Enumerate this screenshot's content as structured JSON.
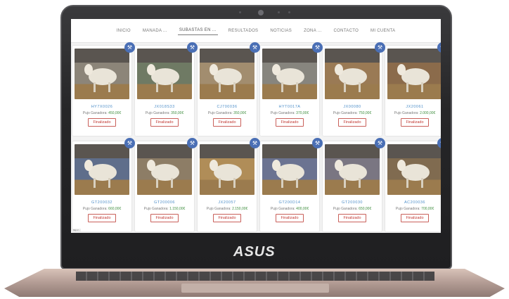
{
  "brand_logo": "ASUS",
  "nav": [
    "INICIO",
    "MANADA ...",
    "SUBASTAS EN ...",
    "RESULTADOS",
    "NOTICIAS",
    "ZONA ...",
    "CONTACTO",
    "MI CUENTA"
  ],
  "nav_active_index": 2,
  "status_label": "Finalizado",
  "price_prefix": "Pujo Ganadora:",
  "url_tip": "http://...",
  "cards": [
    {
      "code": "HY7X0026",
      "price": "450,00€",
      "bg": "#8c8579"
    },
    {
      "code": "JX018S33",
      "price": "350,00€",
      "bg": "#6f7a64"
    },
    {
      "code": "CJ700036",
      "price": "350,00€",
      "bg": "#a28d6f"
    },
    {
      "code": "HYT0017A",
      "price": "370,00€",
      "bg": "#87857e"
    },
    {
      "code": "JX00080",
      "price": "750,00€",
      "bg": "#9a7a55"
    },
    {
      "code": "JX20061",
      "price": "2.000,00€",
      "bg": "#8b6b4b"
    },
    {
      "code": "GT200032",
      "price": "660,00€",
      "bg": "#5f6e8b"
    },
    {
      "code": "GT200006",
      "price": "1.150,00€",
      "bg": "#8d7d66"
    },
    {
      "code": "JX20057",
      "price": "2.150,00€",
      "bg": "#b08d58"
    },
    {
      "code": "GT200D14",
      "price": "400,00€",
      "bg": "#6b7391"
    },
    {
      "code": "GT200030",
      "price": "650,00€",
      "bg": "#7a7682"
    },
    {
      "code": "AC200036",
      "price": "700,00€",
      "bg": "#806b50"
    }
  ]
}
